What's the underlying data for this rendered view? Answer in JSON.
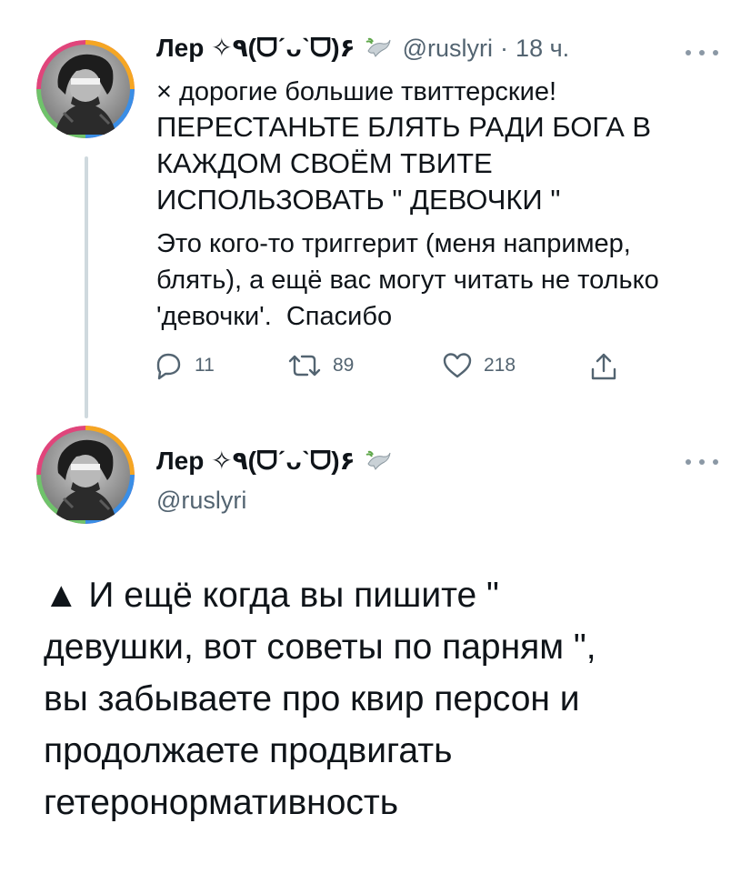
{
  "tweet1": {
    "display_name": "Лер ✧٩(ᗜˊᴗˋᗜ)۶",
    "handle": "@ruslyri",
    "separator": "·",
    "time": "18 ч.",
    "text_line1": "× дорогие большие твиттерские!",
    "text_caps": "ПЕРЕСТАНЬТЕ БЛЯТЬ РАДИ БОГА В\nКАЖДОМ СВОЁМ ТВИТЕ\nИСПОЛЬЗОВАТЬ \" ДЕВОЧКИ \"",
    "text_body": "Это кого-то триггерит (меня например,\nблять), а ещё вас могут читать не только\n'девочки'.  Спасибо",
    "replies": "11",
    "retweets": "89",
    "likes": "218",
    "icons": {
      "verified_badge": "dove-icon",
      "more": "more-icon",
      "reply": "reply-icon",
      "retweet": "retweet-icon",
      "like": "heart-icon",
      "share": "share-icon"
    }
  },
  "tweet2": {
    "display_name": "Лер ✧٩(ᗜˊᴗˋᗜ)۶",
    "handle": "@ruslyri",
    "text": "▲ И ещё когда вы пишите \"\nдевушки, вот советы по парням \",\nвы забываете про квир персон и\nпродолжаете продвигать\nгетеронормативность"
  },
  "colors": {
    "text": "#0f1419",
    "secondary": "#536471",
    "thread_line": "#cfd9de",
    "avatar_ring": [
      "#e0457b",
      "#f5a623",
      "#6fc36b",
      "#3a8ee6",
      "#9b59d0"
    ]
  }
}
